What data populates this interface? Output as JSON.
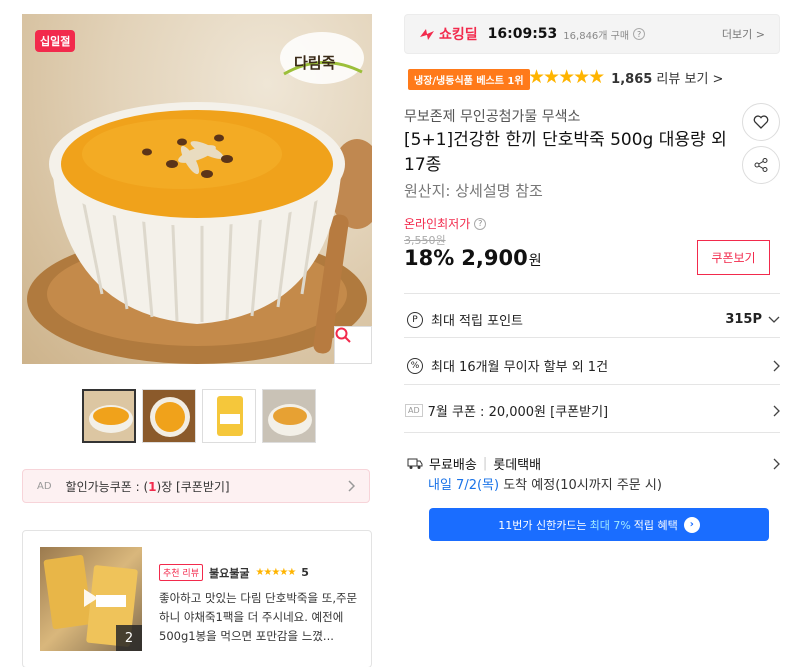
{
  "gallery": {
    "badge": "십일절",
    "brand_logo_text": "다림죽",
    "thumbnails": [
      "thumb-1",
      "thumb-2",
      "thumb-3",
      "thumb-4"
    ]
  },
  "coupon_bar": {
    "ad": "AD",
    "prefix": "할인가능쿠폰 : (",
    "count": "1",
    "suffix": ")장 [쿠폰받기]"
  },
  "review": {
    "badge": "추천 리뷰",
    "reviewer": "불요불굴",
    "stars": "★★★★★",
    "score": "5",
    "media_count": "2",
    "text": "좋아하고 맛있는 다림 단호박죽을 또,주문하니 야채죽1팩을 더 주시네요. 예전에 500g1봉을 먹으면 포만감을 느꼈..."
  },
  "shocking_deal": {
    "label": "쇼킹딜",
    "time": "16:09:53",
    "buy_count": "16,846개 구매",
    "more": "더보기 >"
  },
  "best_badge": "냉장/냉동식품 베스트 1위",
  "rating": {
    "stars": "★★★★★",
    "value": 4.5,
    "count": "1,865",
    "link_suffix": " 리뷰 보기 >"
  },
  "product": {
    "shop": "무보존제 무인공첨가물 무색소",
    "title": "[5+1]건강한 한끼 단호박죽 500g 대용량 외 17종",
    "origin": "원산지: 상세설명 참조"
  },
  "price": {
    "lowest_label": "온라인최저가",
    "original": "3,550원",
    "discount": "18%",
    "value": "2,900",
    "unit": "원",
    "coupon_button": "쿠폰보기"
  },
  "rows": {
    "points_label": "최대 적립 포인트",
    "points_value": "315P",
    "installment": "최대 16개월 무이자 할부 외 1건",
    "coupon": "7월 쿠폰 : 20,000원 [쿠폰받기]"
  },
  "delivery": {
    "free": "무료배송",
    "carrier": "롯데택배",
    "date": "내일 7/2(목)",
    "arrive": " 도착 예정",
    "note": "(10시까지 주문 시)"
  },
  "card_banner": {
    "prefix": "11번가 신한카드는",
    "highlight": "최대 7%",
    "suffix": "적립 혜택"
  },
  "colors": {
    "brand_red": "#f22a4c",
    "best_orange": "#ff7a1a",
    "star": "#ffb400",
    "banner_blue": "#1a6dff",
    "delivery_blue": "#1a73e8"
  }
}
